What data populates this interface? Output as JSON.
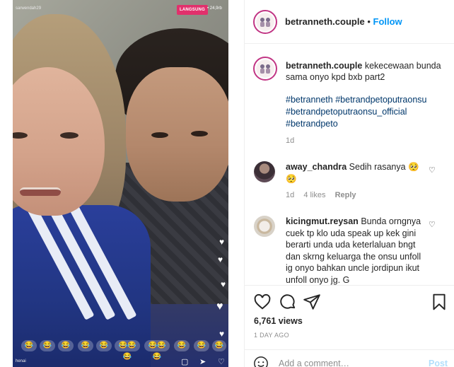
{
  "video": {
    "live_badge": "LANGSUNG",
    "viewer_count": "• 24,9rb",
    "live_user": "sarwendah29",
    "live_subtitle": "henai",
    "emoji_reactions": [
      "😂",
      "😂",
      "😂",
      "😂",
      "😂",
      "😂😂😂",
      "😂😂😂",
      "😂",
      "😂",
      "😂"
    ]
  },
  "header": {
    "username": "betranneth.couple",
    "separator": "•",
    "follow_label": "Follow"
  },
  "caption": {
    "username": "betranneth.couple",
    "text": "kekecewaan bunda sama onyo kpd bxb part2",
    "hashtags": [
      "#betranneth",
      "#betrandpetoputraonsu",
      "#betrandpetoputraonsu_official",
      "#betrandpeto"
    ],
    "time": "1d"
  },
  "comments": [
    {
      "username": "away_chandra",
      "text": "Sedih rasanya 🥺 🥺",
      "time": "1d",
      "likes": "4 likes",
      "reply": "Reply"
    },
    {
      "username": "kicingmut.reysan",
      "text": "Bunda orngnya cuek tp klo uda speak up kek gini berarti unda uda keterlaluan bngt dan skrng keluarga the onsu unfoll ig onyo bahkan uncle jordipun ikut unfoll onyo jg. G"
    }
  ],
  "stats": {
    "views": "6,761 views",
    "time_ago": "1 DAY AGO"
  },
  "add_comment": {
    "placeholder": "Add a comment…",
    "post_label": "Post"
  },
  "colors": {
    "follow": "#0095f6",
    "hashtag": "#00376b",
    "live_badge": "#e1306c",
    "post_disabled": "#b2dffc"
  }
}
